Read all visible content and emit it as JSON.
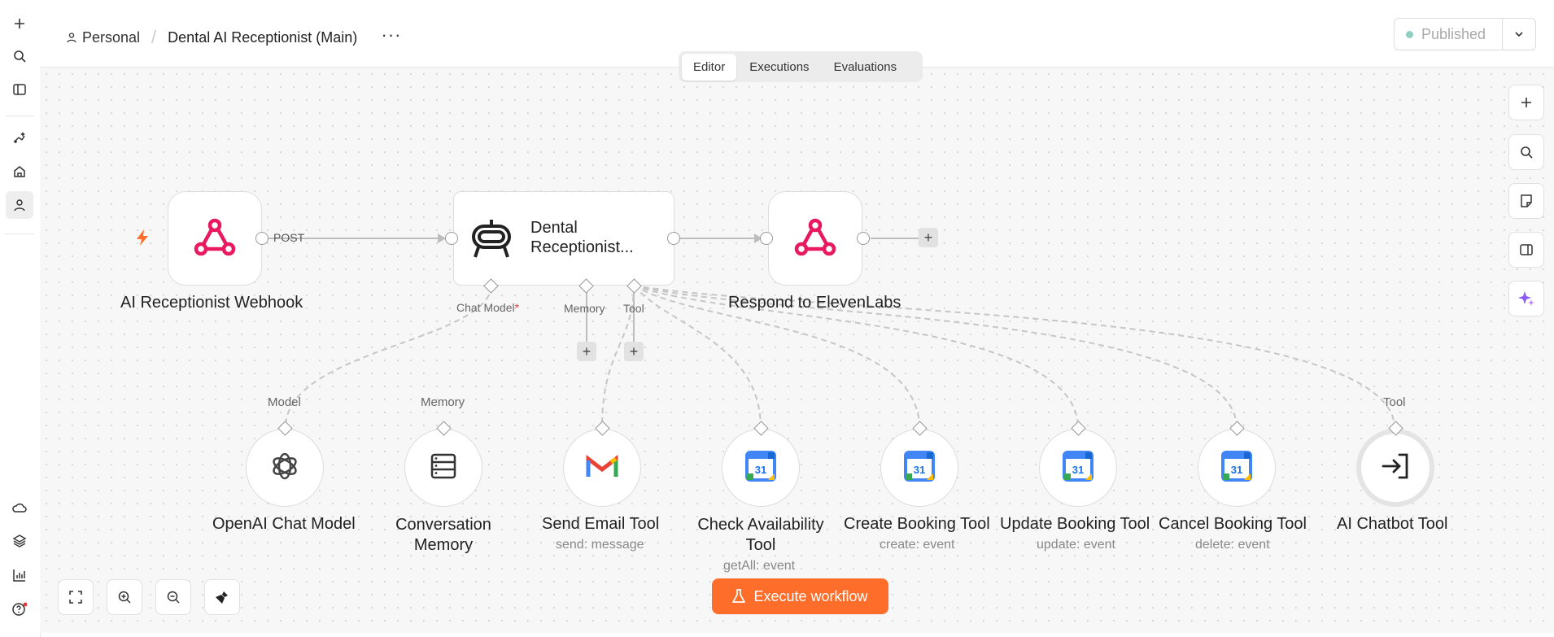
{
  "header": {
    "breadcrumb_project": "Personal",
    "breadcrumb_separator": "/",
    "workflow_title": "Dental AI Receptionist (Main)",
    "more_label": "···",
    "publish_label": "Published"
  },
  "tabs": [
    {
      "label": "Editor",
      "active": true
    },
    {
      "label": "Executions",
      "active": false
    },
    {
      "label": "Evaluations",
      "active": false
    }
  ],
  "nodes": {
    "webhook": {
      "label": "AI Receptionist Webhook",
      "output_label": "POST"
    },
    "agent": {
      "label": "Dental Receptionist...",
      "ports": {
        "chat_model": "Chat Model",
        "required": "*",
        "memory": "Memory",
        "tool": "Tool"
      }
    },
    "respond": {
      "label": "Respond to ElevenLabs"
    },
    "openai": {
      "label": "OpenAI Chat Model",
      "port_label": "Model"
    },
    "memory": {
      "label_line1": "Conversation",
      "label_line2": "Memory",
      "port_label": "Memory"
    },
    "email": {
      "label": "Send Email Tool",
      "subtitle": "send: message"
    },
    "availability": {
      "label_line1": "Check Availability",
      "label_line2": "Tool",
      "subtitle": "getAll: event"
    },
    "create": {
      "label": "Create Booking Tool",
      "subtitle": "create: event"
    },
    "update": {
      "label": "Update Booking Tool",
      "subtitle": "update: event"
    },
    "cancel": {
      "label": "Cancel Booking Tool",
      "subtitle": "delete: event"
    },
    "chatbot": {
      "label": "AI Chatbot Tool",
      "port_label": "Tool"
    }
  },
  "calendar_day": "31",
  "execute_label": "Execute workflow",
  "colors": {
    "accent": "#ff6d2b",
    "webhook": "#e8195e",
    "published_dot": "#8ecfc1"
  }
}
